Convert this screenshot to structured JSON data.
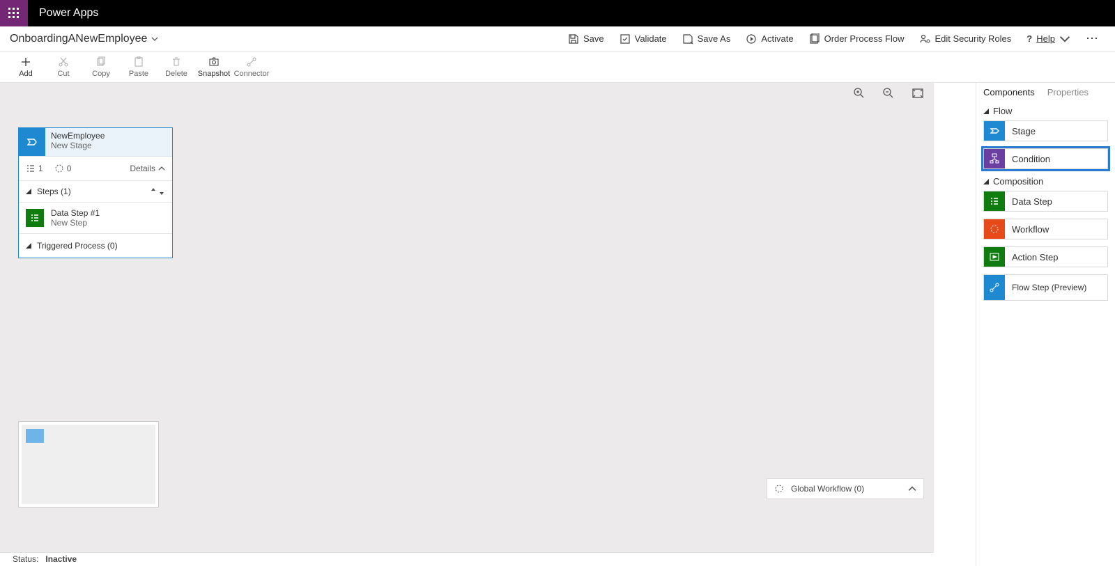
{
  "brand": "Power Apps",
  "flow_name": "OnboardingANewEmployee",
  "commands": {
    "save": "Save",
    "validate": "Validate",
    "save_as": "Save As",
    "activate": "Activate",
    "order": "Order Process Flow",
    "security": "Edit Security Roles",
    "help": "Help"
  },
  "tools": {
    "add": "Add",
    "cut": "Cut",
    "copy": "Copy",
    "paste": "Paste",
    "delete": "Delete",
    "snapshot": "Snapshot",
    "connector": "Connector"
  },
  "stage": {
    "title": "NewEmployee",
    "subtitle": "New Stage",
    "step_count": "1",
    "trigger_count": "0",
    "details_label": "Details",
    "steps_label": "Steps (1)",
    "step_title": "Data Step #1",
    "step_sub": "New Step",
    "triggered_label": "Triggered Process (0)"
  },
  "global_workflow": "Global Workflow (0)",
  "right_panel": {
    "tab_components": "Components",
    "tab_properties": "Properties",
    "section_flow": "Flow",
    "section_composition": "Composition",
    "items": {
      "stage": "Stage",
      "condition": "Condition",
      "data_step": "Data Step",
      "workflow": "Workflow",
      "action_step": "Action Step",
      "flow_step": "Flow Step (Preview)"
    }
  },
  "status": {
    "label": "Status:",
    "value": "Inactive"
  }
}
